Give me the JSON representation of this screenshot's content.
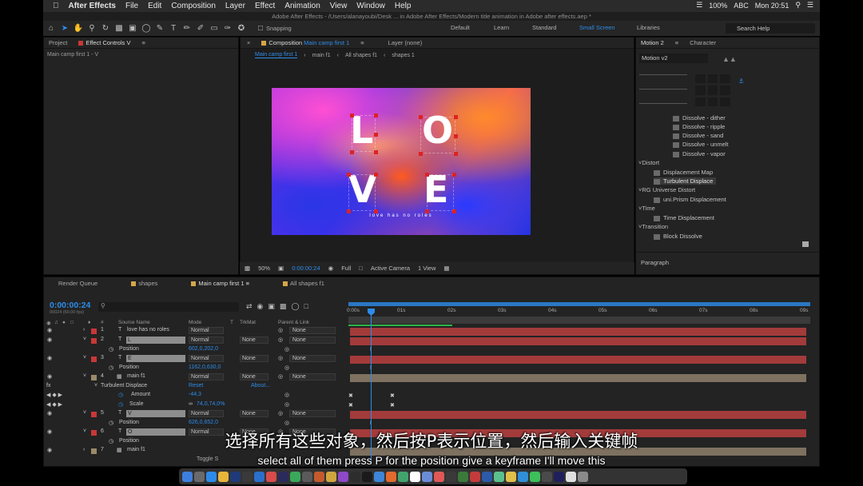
{
  "menubar": {
    "app": "After Effects",
    "items": [
      "File",
      "Edit",
      "Composition",
      "Layer",
      "Effect",
      "Animation",
      "View",
      "Window",
      "Help"
    ],
    "input_source": "ABC",
    "clock": "Mon 20:51",
    "battery": "100%"
  },
  "window_title": "Adobe After Effects - /Users/alanayoubi/Desk ... in Adobe After Effects/Modern title animation in Adobe after effects.aep *",
  "toolbar": {
    "snapping_label": "Snapping",
    "workspaces": [
      "Default",
      "Learn",
      "Standard",
      "Small Screen",
      "Libraries"
    ],
    "active_workspace": "Small Screen",
    "search_placeholder": "Search Help"
  },
  "left_panel": {
    "tabs": [
      "Project",
      "Effect Controls V"
    ],
    "subtitle": "Main camp first 1 - V"
  },
  "comp_panel": {
    "tab_prefix": "Composition",
    "tab_name": "Main camp first 1",
    "layer_tab": "Layer (none)",
    "breadcrumbs": [
      "Main camp first 1",
      "main f1",
      "All shapes f1",
      "shapes 1"
    ],
    "letters": [
      "L",
      "O",
      "V",
      "E"
    ],
    "tagline": "love has no roles",
    "zoom": "50%",
    "timecode": "0:00:00:24",
    "resolution": "Full",
    "camera": "Active Camera",
    "views": "1 View"
  },
  "right_panel": {
    "tabs": [
      "Motion 2",
      "Character"
    ],
    "motion_select": "Motion v2",
    "effects": [
      {
        "label": "Dissolve - dither",
        "type": "item"
      },
      {
        "label": "Dissolve - ripple",
        "type": "item"
      },
      {
        "label": "Dissolve - sand",
        "type": "item"
      },
      {
        "label": "Dissolve - unmelt",
        "type": "item"
      },
      {
        "label": "Dissolve - vapor",
        "type": "item"
      },
      {
        "label": "Distort",
        "type": "category"
      },
      {
        "label": "Displacement Map",
        "type": "item"
      },
      {
        "label": "Turbulent Displace",
        "type": "selected"
      },
      {
        "label": "RG Universe Distort",
        "type": "category"
      },
      {
        "label": "uni.Prism Displacement",
        "type": "item"
      },
      {
        "label": "Time",
        "type": "category"
      },
      {
        "label": "Time Displacement",
        "type": "item"
      },
      {
        "label": "Transition",
        "type": "category"
      },
      {
        "label": "Block Dissolve",
        "type": "item"
      }
    ],
    "paragraph_label": "Paragraph"
  },
  "timeline": {
    "tabs": [
      "Render Queue",
      "shapes",
      "Main camp first 1",
      "All shapes f1"
    ],
    "timecode": "0:00:00:24",
    "fps": "00024 (60.00 fps)",
    "columns": [
      "#",
      "Source Name",
      "Mode",
      "T",
      "TrkMat",
      "Parent & Link"
    ],
    "ruler": [
      "0:00s",
      "01s",
      "02s",
      "03s",
      "04s",
      "05s",
      "06s",
      "07s",
      "08s",
      "09s"
    ],
    "rows": [
      {
        "kind": "layer",
        "num": "1",
        "name": "love has no roles",
        "mode": "Normal",
        "trk": "",
        "parent": "None",
        "color": "#c83737",
        "bar": "#a33b3b"
      },
      {
        "kind": "layer",
        "num": "2",
        "name": "L",
        "mode": "Normal",
        "trk": "None",
        "parent": "None",
        "color": "#c83737",
        "bar": "#a33b3b",
        "boxed": true
      },
      {
        "kind": "prop",
        "name": "Position",
        "value": "602,0,202,0"
      },
      {
        "kind": "layer",
        "num": "3",
        "name": "E",
        "mode": "Normal",
        "trk": "None",
        "parent": "None",
        "color": "#c83737",
        "bar": "#a33b3b",
        "boxed": true
      },
      {
        "kind": "prop",
        "name": "Position",
        "value": "1162,0,630,0"
      },
      {
        "kind": "layer",
        "num": "4",
        "name": "main f1",
        "mode": "Normal",
        "trk": "None",
        "parent": "None",
        "color": "#9a8a6a",
        "bar": "#7e7160"
      },
      {
        "kind": "effect",
        "name": "Turbulent Displace",
        "value": "Reset",
        "extra": "About..."
      },
      {
        "kind": "prop",
        "name": "Amount",
        "value": "-44,3"
      },
      {
        "kind": "prop",
        "name": "Scale",
        "value": "74,0,74,0%"
      },
      {
        "kind": "layer",
        "num": "5",
        "name": "V",
        "mode": "Normal",
        "trk": "None",
        "parent": "None",
        "color": "#c83737",
        "bar": "#a33b3b",
        "boxed": true
      },
      {
        "kind": "prop",
        "name": "Position",
        "value": "626,0,652,0"
      },
      {
        "kind": "layer",
        "num": "6",
        "name": "O",
        "mode": "Normal",
        "trk": "None",
        "parent": "None",
        "color": "#c83737",
        "bar": "#a33b3b",
        "boxed": true
      },
      {
        "kind": "prop",
        "name": "Position",
        "value": ""
      },
      {
        "kind": "layer",
        "num": "7",
        "name": "main f1",
        "mode": "",
        "trk": "",
        "parent": "",
        "color": "#9a8a6a",
        "bar": "#7e7160"
      }
    ],
    "toggle_label": "Toggle S"
  },
  "subtitles": {
    "chinese": "选择所有这些对象，然后按P表示位置，然后输入关键帧",
    "english": "select all of them press P for the position give a keyframe I'll move this"
  },
  "colors": {
    "accent": "#2d8ceb",
    "panel": "#232323",
    "layer_red": "#a33b3b",
    "layer_tan": "#7e7160"
  }
}
